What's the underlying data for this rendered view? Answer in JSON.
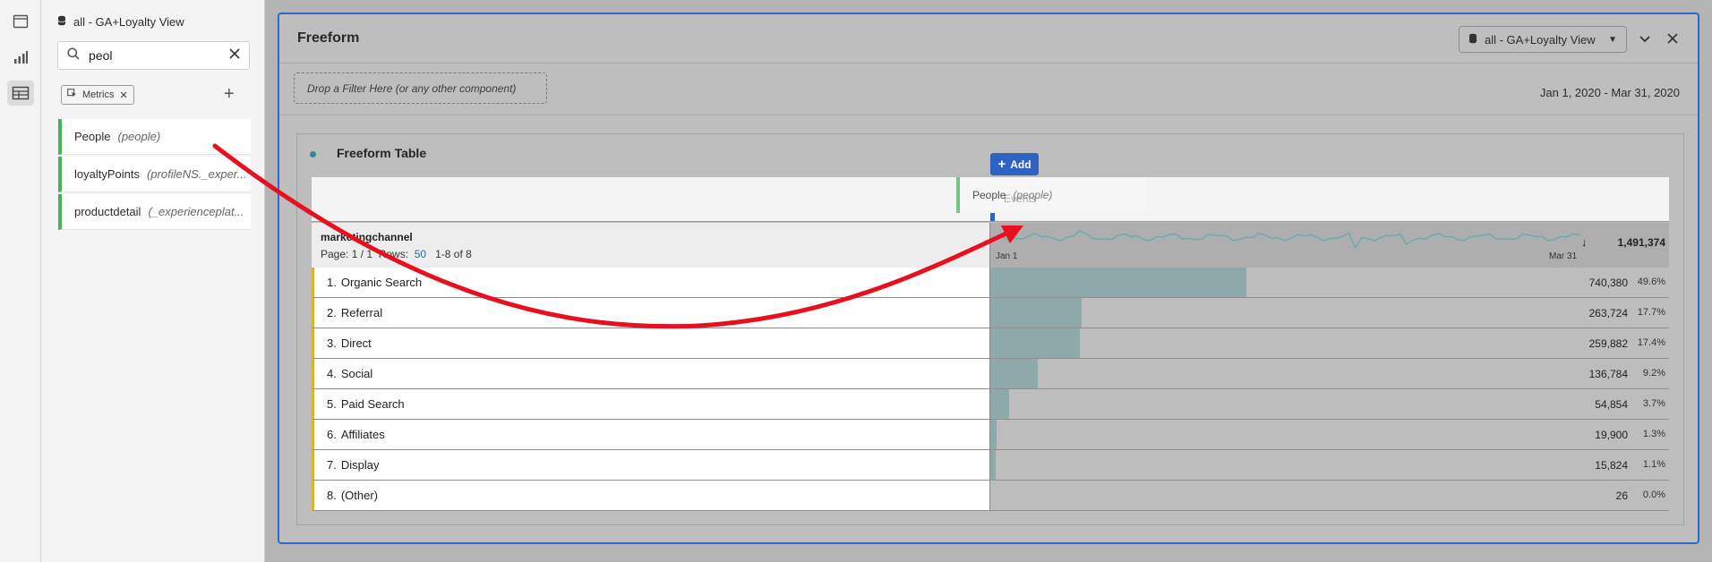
{
  "rail": {
    "items": [
      {
        "icon": "panel-icon"
      },
      {
        "icon": "bar-chart-icon"
      },
      {
        "icon": "table-icon",
        "active": true
      }
    ]
  },
  "left_panel": {
    "dataset_name": "all - GA+Loyalty View",
    "search": {
      "value": "peol"
    },
    "filter_chip": {
      "label": "Metrics"
    },
    "components": [
      {
        "name": "People",
        "id": "(people)"
      },
      {
        "name": "loyaltyPoints",
        "id": "(profileNS._exper..."
      },
      {
        "name": "productdetail",
        "id": "(_experienceplat..."
      }
    ]
  },
  "panel": {
    "title": "Freeform",
    "dataset_dropdown": "all - GA+Loyalty View",
    "filter_drop_text": "Drop a Filter Here (or any other component)",
    "date_range": "Jan 1, 2020 - Mar 31, 2020"
  },
  "table": {
    "title": "Freeform Table",
    "dimension": "marketingchannel",
    "pager": {
      "page_text": "Page: 1 / 1",
      "rows_label": "Rows:",
      "rows_value": "50",
      "range": "1-8 of 8"
    },
    "metric_header": {
      "start_label": "Jan 1",
      "end_label": "Mar 31",
      "total": "1,491,374"
    },
    "rows": [
      {
        "rank": "1.",
        "label": "Organic Search",
        "value": 740380,
        "value_text": "740,380",
        "pct": "49.6%",
        "share": 0.496
      },
      {
        "rank": "2.",
        "label": "Referral",
        "value": 263724,
        "value_text": "263,724",
        "pct": "17.7%",
        "share": 0.177
      },
      {
        "rank": "3.",
        "label": "Direct",
        "value": 259882,
        "value_text": "259,882",
        "pct": "17.4%",
        "share": 0.174
      },
      {
        "rank": "4.",
        "label": "Social",
        "value": 136784,
        "value_text": "136,784",
        "pct": "9.2%",
        "share": 0.092
      },
      {
        "rank": "5.",
        "label": "Paid Search",
        "value": 54854,
        "value_text": "54,854",
        "pct": "3.7%",
        "share": 0.037
      },
      {
        "rank": "6.",
        "label": "Affiliates",
        "value": 19900,
        "value_text": "19,900",
        "pct": "1.3%",
        "share": 0.013
      },
      {
        "rank": "7.",
        "label": "Display",
        "value": 15824,
        "value_text": "15,824",
        "pct": "1.1%",
        "share": 0.011
      },
      {
        "rank": "8.",
        "label": "(Other)",
        "value": 26,
        "value_text": "26",
        "pct": "0.0%",
        "share": 0.0
      }
    ]
  },
  "drag": {
    "add_label": "Add",
    "ghost_name": "People",
    "ghost_id": "(people)",
    "underlying_text": "Events"
  },
  "colors": {
    "accent_blue": "#2e63c3",
    "component_green": "#44b556",
    "row_marker": "#e0b22f",
    "bar_fill": "#8ea9aa",
    "sparkline": "#6aa8ad",
    "annotation_arrow": "#e8101e"
  }
}
